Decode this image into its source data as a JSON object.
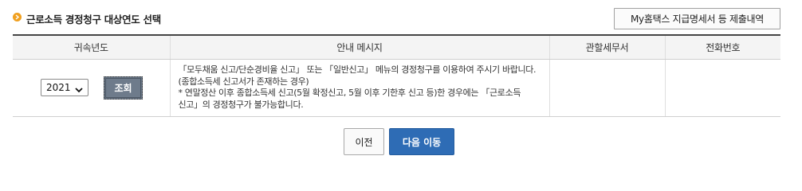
{
  "section": {
    "title": "근로소득 경정청구 대상연도 선택",
    "bullet_icon": "chevron-right-circle-icon",
    "accent_color": "#f0a020",
    "payment_statement_button": "My홈택스 지급명세서 등 제출내역"
  },
  "table": {
    "headers": {
      "year": "귀속년도",
      "message": "안내 메시지",
      "tax_office": "관할세무서",
      "phone": "전화번호"
    },
    "row": {
      "selected_year": "2021",
      "inquiry_button": "조회",
      "message_lines": [
        "「모두채움 신고/단순경비율 신고」 또는 「일반신고」 메뉴의 경정청구를 이용하여 주시기 바랍니다.(종합소득세 신고서가 존재하는 경우)",
        "* 연말정산 이후 종합소득세 신고(5월 확정신고, 5월 이후 기한후 신고 등)한 경우에는 「근로소득 신고」의 경정청구가 불가능합니다."
      ],
      "tax_office": "",
      "phone": ""
    }
  },
  "actions": {
    "prev_label": "이전",
    "next_label": "다음 이동",
    "next_color": "#2e6cb5"
  }
}
